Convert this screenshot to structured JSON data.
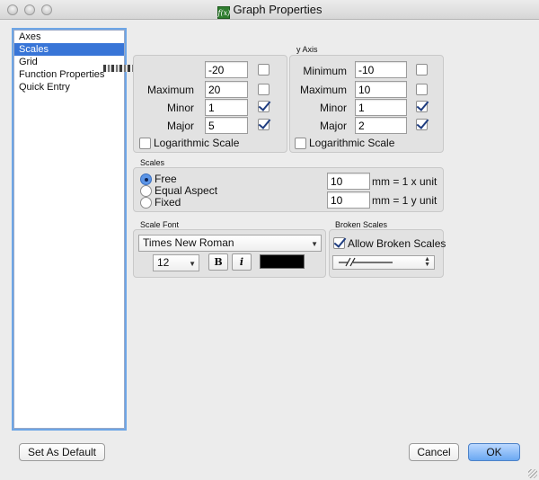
{
  "window": {
    "title": "Graph Properties",
    "app_icon_text": "f(x)"
  },
  "sidebar": {
    "items": [
      {
        "label": "Axes",
        "selected": false
      },
      {
        "label": "Scales",
        "selected": true
      },
      {
        "label": "Grid",
        "selected": false
      },
      {
        "label": "Function Properties",
        "selected": false
      },
      {
        "label": "Quick Entry",
        "selected": false
      }
    ]
  },
  "x_axis": {
    "minimum_value": "-20",
    "minimum_auto": false,
    "maximum_label": "Maximum",
    "maximum_value": "20",
    "maximum_auto": false,
    "minor_label": "Minor",
    "minor_value": "1",
    "minor_auto": true,
    "major_label": "Major",
    "major_value": "5",
    "major_auto": true,
    "logarithmic_label": "Logarithmic Scale",
    "logarithmic": false
  },
  "y_axis": {
    "group_title": "y Axis",
    "minimum_label": "Minimum",
    "minimum_value": "-10",
    "minimum_auto": false,
    "maximum_label": "Maximum",
    "maximum_value": "10",
    "maximum_auto": false,
    "minor_label": "Minor",
    "minor_value": "1",
    "minor_auto": true,
    "major_label": "Major",
    "major_value": "2",
    "major_auto": true,
    "logarithmic_label": "Logarithmic Scale",
    "logarithmic": false
  },
  "scales": {
    "group_title": "Scales",
    "options": [
      {
        "label": "Free",
        "selected": true
      },
      {
        "label": "Equal Aspect",
        "selected": false
      },
      {
        "label": "Fixed",
        "selected": false
      }
    ],
    "x_mm_value": "10",
    "x_unit_label": "mm = 1 x unit",
    "y_mm_value": "10",
    "y_unit_label": "mm = 1 y unit"
  },
  "scale_font": {
    "group_title": "Scale Font",
    "family": "Times New Roman",
    "size": "12",
    "bold_label": "B",
    "italic_label": "i",
    "color": "#000000"
  },
  "broken_scales": {
    "group_title": "Broken Scales",
    "allow_label": "Allow Broken Scales",
    "allow": true
  },
  "footer": {
    "set_default_label": "Set As Default",
    "cancel_label": "Cancel",
    "ok_label": "OK"
  },
  "colors": {
    "accent": "#3875d7",
    "ok_button": "#6aa8f2"
  }
}
